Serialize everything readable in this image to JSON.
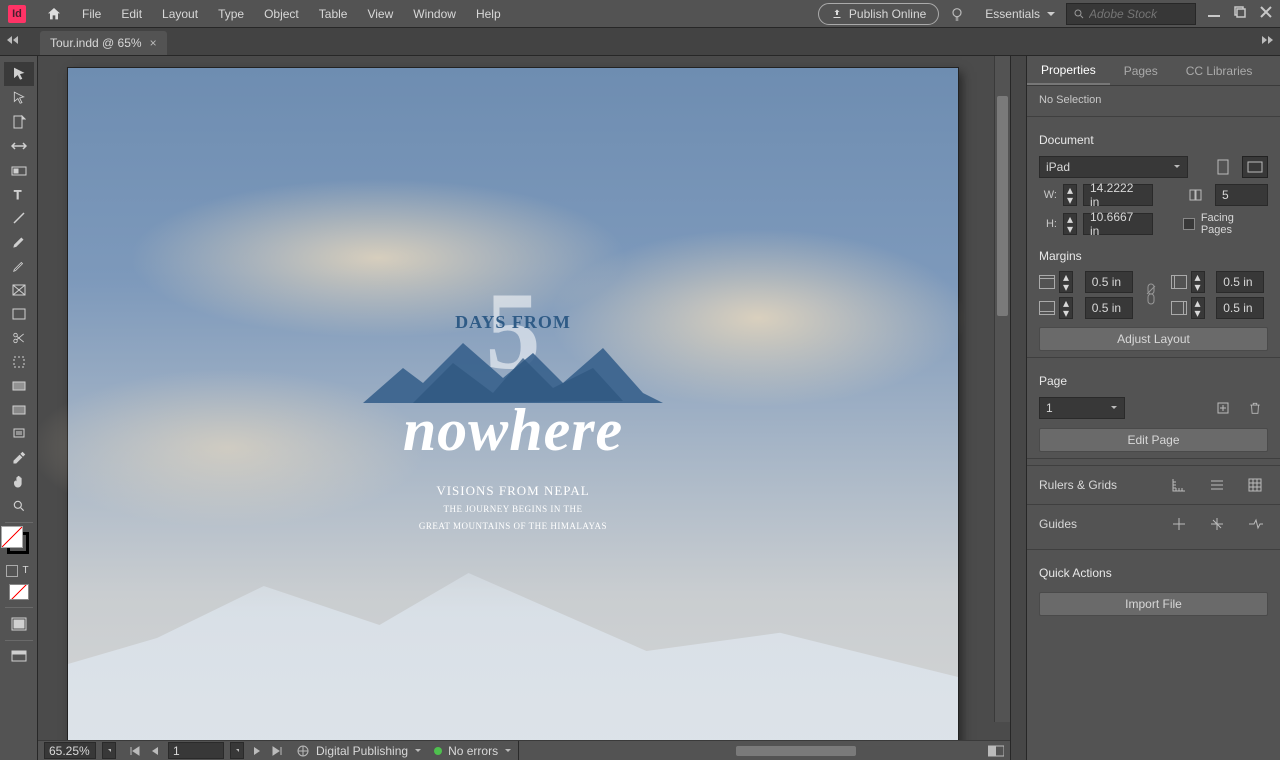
{
  "menu": {
    "items": [
      "File",
      "Edit",
      "Layout",
      "Type",
      "Object",
      "Table",
      "View",
      "Window",
      "Help"
    ]
  },
  "publish_label": "Publish Online",
  "workspace": "Essentials",
  "stock_placeholder": "Adobe Stock",
  "tab": {
    "title": "Tour.indd @ 65%"
  },
  "statusbar": {
    "zoom": "65.25%",
    "page": "1",
    "intent": "Digital Publishing",
    "errors": "No errors"
  },
  "artwork": {
    "big_number": "5",
    "days_from": "DAYS FROM",
    "title": "nowhere",
    "subtitle": "VISIONS FROM NEPAL",
    "tagline1": "THE JOURNEY BEGINS IN THE",
    "tagline2": "GREAT MOUNTAINS OF THE HIMALAYAS"
  },
  "panel": {
    "tabs": [
      "Properties",
      "Pages",
      "CC Libraries"
    ],
    "no_selection": "No Selection",
    "document_label": "Document",
    "preset": "iPad",
    "w_label": "W:",
    "w_value": "14.2222 in",
    "h_label": "H:",
    "h_value": "10.6667 in",
    "pages_field_label": "",
    "pages_value": "5",
    "facing_label": "Facing Pages",
    "margins_label": "Margins",
    "margin_top": "0.5 in",
    "margin_bottom": "0.5 in",
    "margin_left": "0.5 in",
    "margin_right": "0.5 in",
    "adjust_layout": "Adjust Layout",
    "page_label": "Page",
    "page_value": "1",
    "edit_page": "Edit Page",
    "rulers_label": "Rulers & Grids",
    "guides_label": "Guides",
    "quick_actions": "Quick Actions",
    "import_file": "Import File"
  }
}
